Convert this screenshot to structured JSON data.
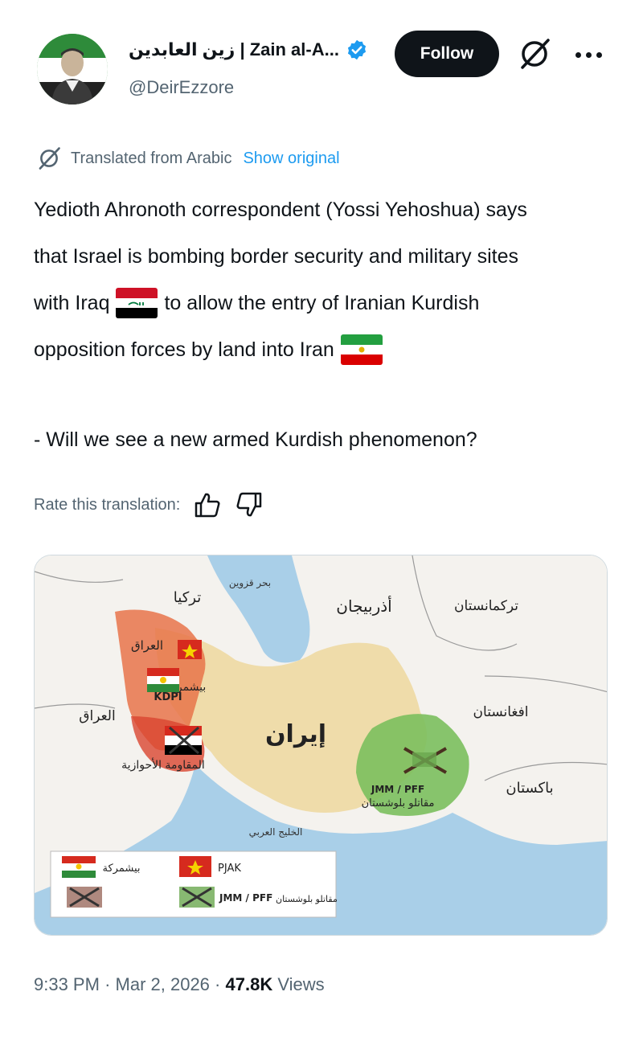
{
  "author": {
    "display_name": "زين العابدين | Zain al-A...",
    "handle": "@DeirEzzore",
    "follow_label": "Follow"
  },
  "translation": {
    "label": "Translated from Arabic",
    "show_original": "Show original"
  },
  "post": {
    "lines": [
      "Yedioth Ahronoth correspondent (Yossi Yehoshua) says",
      "that Israel is bombing border security and military sites",
      "with Iraq",
      "to allow the entry of Iranian Kurdish",
      "opposition forces by land into Iran"
    ],
    "question": "- Will we see a new armed Kurdish phenomenon?"
  },
  "rate": {
    "label": "Rate this translation:"
  },
  "map": {
    "labels": {
      "turkey": "تركيا",
      "caspian": "بحر قزوين",
      "azerbaijan": "أذربيجان",
      "turkmenistan": "تركمانستان",
      "afghanistan": "افغانستان",
      "pakistan": "باكستان",
      "iran": "إيران",
      "iraq": "العراق",
      "iraq_region": "العراق",
      "peshmerga": "بيشمركة",
      "kdpi": "KDPI",
      "ahwaz": "المقاومة الأحوازية",
      "jmm": "JMM / PFF",
      "baloch": "مقاتلو بلوشستان",
      "gulf": "الخليج العربي"
    },
    "legend": {
      "peshmerga": "بيشمركة",
      "pjak": "PJAK",
      "jmm_pff": "JMM / PFF",
      "baloch": "مقاتلو بلوشستان"
    }
  },
  "meta": {
    "time": "9:33 PM",
    "sep1": "·",
    "date": "Mar 2, 2026",
    "sep2": "·",
    "views_num": "47.8K",
    "views_label": "Views"
  },
  "colors": {
    "accent": "#1d9bf0",
    "text": "#0f1419",
    "muted": "#536471"
  }
}
